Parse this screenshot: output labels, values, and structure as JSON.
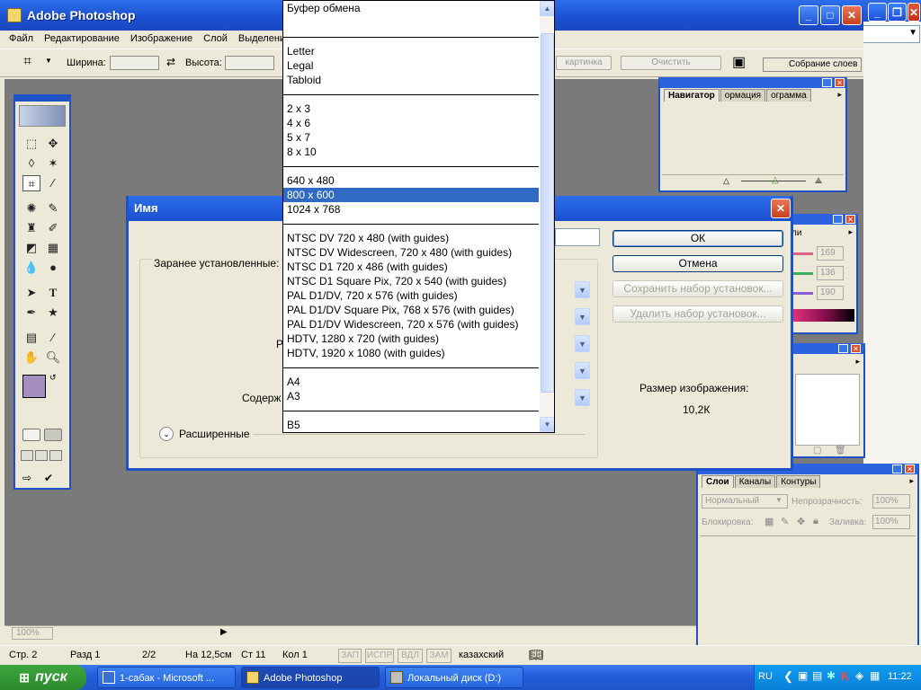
{
  "photoshop": {
    "title": "Adobe Photoshop",
    "menu": [
      "Файл",
      "Редактирование",
      "Изображение",
      "Слой",
      "Выделени"
    ],
    "options": {
      "width_label": "Ширина:",
      "height_label": "Высота:",
      "image_button": "картинка",
      "clear_button": "Очистить",
      "layers_comp": "Собрание слоев"
    },
    "zoom": "100%"
  },
  "navigator_panel": {
    "tabs": [
      "Навигатор",
      "ормация",
      "ограмма"
    ]
  },
  "color_panel": {
    "tab": "ли",
    "values": [
      "169",
      "136",
      "190"
    ]
  },
  "layers_panel": {
    "tabs": [
      "Слои",
      "Каналы",
      "Контуры"
    ],
    "blend_mode": "Нормальный",
    "opacity_label": "Непрозрачность:",
    "opacity_value": "100%",
    "lock_label": "Блокировка:",
    "fill_label": "Заливка:",
    "fill_value": "100%"
  },
  "dialog": {
    "title": "Имя",
    "presets_label": "Заранее установленные:",
    "partial_label_r": "Р",
    "contents_label": "Содерж",
    "advanced_label": "Расширенные",
    "ok": "ОК",
    "cancel": "Отмена",
    "save_preset": "Сохранить набор установок...",
    "delete_preset": "Удалить набор установок...",
    "image_size_label": "Размер изображения:",
    "image_size_value": "10,2К"
  },
  "preset_list": {
    "selected": "800 x 600",
    "items": [
      "Буфер обмена",
      "",
      "-",
      "Letter",
      "Legal",
      "Tabloid",
      "-",
      "2 x 3",
      "4 x 6",
      "5 x 7",
      "8 x 10",
      "-",
      "640 x 480",
      "800 x 600",
      "1024 x 768",
      "-",
      "NTSC DV 720 x 480 (with guides)",
      "NTSC DV Widescreen, 720 x 480 (with guides)",
      "NTSC D1 720 x 486 (with guides)",
      "NTSC D1 Square Pix, 720 x 540 (with guides)",
      "PAL D1/DV, 720 x 576 (with guides)",
      "PAL D1/DV Square Pix, 768 x 576 (with guides)",
      "PAL D1/DV Widescreen, 720 x 576 (with guides)",
      "HDTV, 1280 x 720 (with guides)",
      "HDTV, 1920 x 1080 (with guides)",
      "-",
      "A4",
      "A3",
      "-",
      "B5"
    ]
  },
  "statusbar": {
    "page": "Стр. 2",
    "section": "Разд 1",
    "pages": "2/2",
    "position": "На 12,5см",
    "line": "Ст 11",
    "column": "Кол 1",
    "rec": "ЗАП",
    "trk": "ИСПР",
    "ext": "ВДЛ",
    "ovr": "ЗАМ",
    "language": "казахский"
  },
  "taskbar": {
    "start": "пуск",
    "tasks": [
      "1-сабак - Microsoft ...",
      "Adobe Photoshop",
      "Локальный диск (D:)"
    ],
    "lang": "RU",
    "clock": "11:22"
  }
}
